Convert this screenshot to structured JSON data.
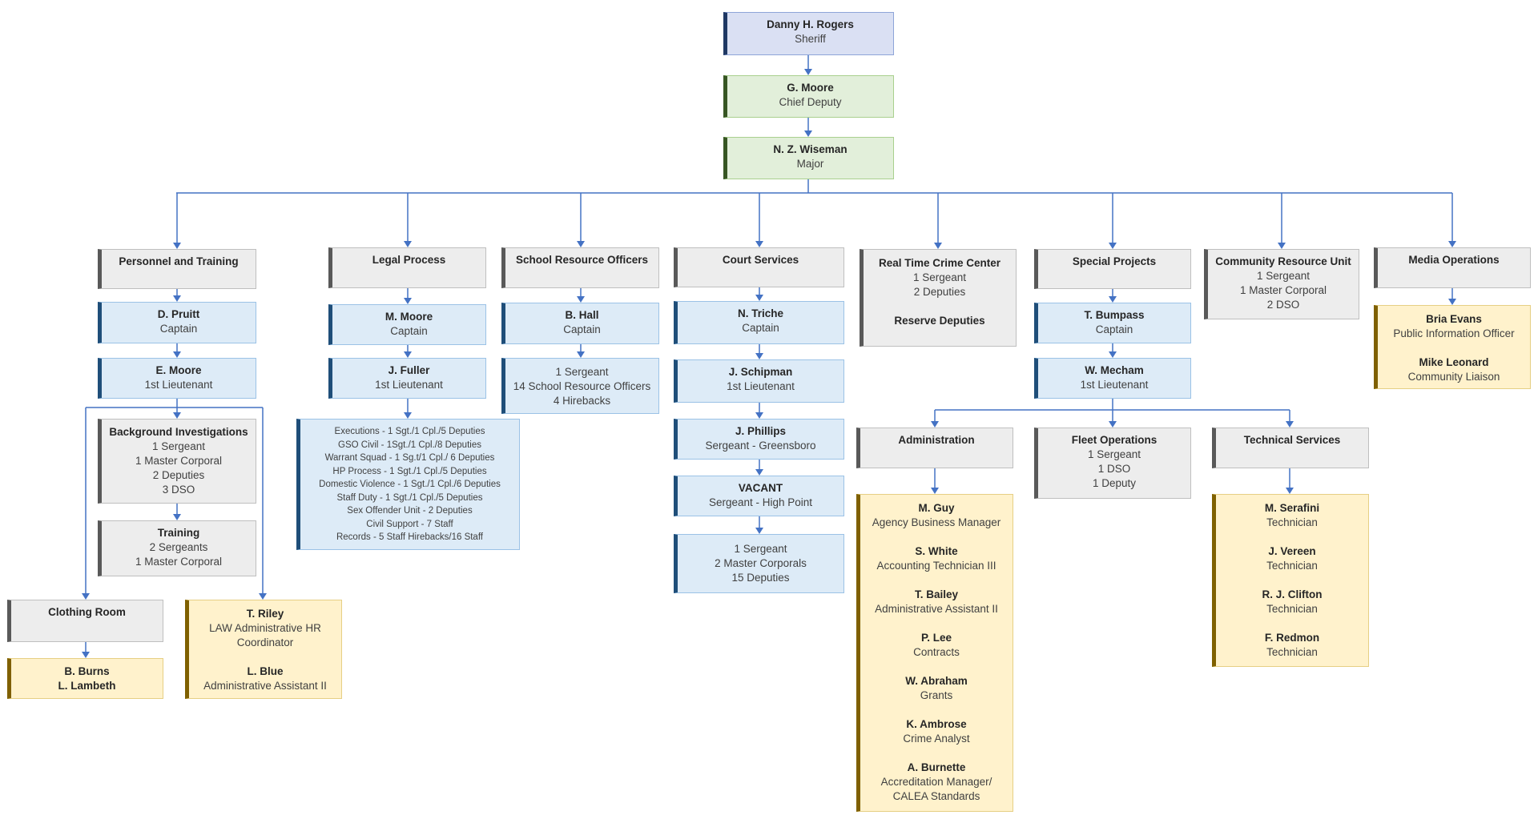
{
  "palette": {
    "connector": "#4472c4",
    "sheriff": {
      "fill": "#dae0f3",
      "border": "#8ea4d8",
      "bar": "#1f3864"
    },
    "command": {
      "fill": "#e2efda",
      "border": "#a9d08e",
      "bar": "#375623"
    },
    "unit": {
      "fill": "#ededed",
      "border": "#bfbfbf",
      "bar": "#595959"
    },
    "officer": {
      "fill": "#ddebf7",
      "border": "#9bc2e6",
      "bar": "#1f4e79"
    },
    "civilian": {
      "fill": "#fff2cc",
      "border": "#e6cf84",
      "bar": "#7f6000"
    }
  },
  "nodes": [
    {
      "id": "sheriff",
      "style": "sheriff",
      "lines": [
        {
          "t": "Danny H. Rogers",
          "b": true
        },
        {
          "t": "Sheriff"
        }
      ]
    },
    {
      "id": "chief-deputy",
      "style": "command",
      "lines": [
        {
          "t": "G. Moore",
          "b": true
        },
        {
          "t": "Chief Deputy"
        }
      ]
    },
    {
      "id": "major",
      "style": "command",
      "lines": [
        {
          "t": "N. Z. Wiseman",
          "b": true
        },
        {
          "t": "Major"
        }
      ]
    },
    {
      "id": "personnel-training",
      "style": "unit",
      "lines": [
        {
          "t": "Personnel and Training",
          "b": true
        }
      ]
    },
    {
      "id": "d-pruitt",
      "style": "officer",
      "lines": [
        {
          "t": "D. Pruitt",
          "b": true
        },
        {
          "t": "Captain"
        }
      ]
    },
    {
      "id": "e-moore",
      "style": "officer",
      "lines": [
        {
          "t": "E. Moore",
          "b": true
        },
        {
          "t": "1st Lieutenant"
        }
      ]
    },
    {
      "id": "background-investigations",
      "style": "unit",
      "lines": [
        {
          "t": "Background Investigations",
          "b": true
        },
        {
          "t": "1 Sergeant"
        },
        {
          "t": "1 Master Corporal"
        },
        {
          "t": "2 Deputies"
        },
        {
          "t": "3 DSO"
        }
      ]
    },
    {
      "id": "training",
      "style": "unit",
      "lines": [
        {
          "t": "Training",
          "b": true
        },
        {
          "t": "2 Sergeants"
        },
        {
          "t": "1 Master Corporal"
        }
      ]
    },
    {
      "id": "clothing-room",
      "style": "unit",
      "lines": [
        {
          "t": "Clothing Room",
          "b": true
        }
      ]
    },
    {
      "id": "clothing-staff",
      "style": "civilian",
      "lines": [
        {
          "t": "B. Burns",
          "b": true
        },
        {
          "t": "L. Lambeth",
          "b": true
        }
      ]
    },
    {
      "id": "hr-staff",
      "style": "civilian",
      "lines": [
        {
          "t": "T. Riley",
          "b": true
        },
        {
          "t": "LAW Administrative HR"
        },
        {
          "t": "Coordinator"
        },
        {
          "t": ""
        },
        {
          "t": "L. Blue",
          "b": true
        },
        {
          "t": "Administrative Assistant II"
        }
      ]
    },
    {
      "id": "legal-process",
      "style": "unit",
      "lines": [
        {
          "t": "Legal Process",
          "b": true
        }
      ]
    },
    {
      "id": "m-moore",
      "style": "officer",
      "lines": [
        {
          "t": "M. Moore",
          "b": true
        },
        {
          "t": "Captain"
        }
      ]
    },
    {
      "id": "j-fuller",
      "style": "officer",
      "lines": [
        {
          "t": "J. Fuller",
          "b": true
        },
        {
          "t": "1st Lieutenant"
        }
      ]
    },
    {
      "id": "legal-units",
      "style": "officer",
      "small": true,
      "lines": [
        {
          "t": "Executions - 1 Sgt./1 Cpl./5 Deputies"
        },
        {
          "t": "GSO Civil - 1Sgt./1 Cpl./8 Deputies"
        },
        {
          "t": "Warrant Squad - 1 Sg.t/1 Cpl./ 6 Deputies"
        },
        {
          "t": "HP Process - 1 Sgt./1 Cpl./5 Deputies"
        },
        {
          "t": "Domestic Violence - 1 Sgt./1 Cpl./6 Deputies"
        },
        {
          "t": "Staff Duty - 1 Sgt./1 Cpl./5 Deputies"
        },
        {
          "t": "Sex Offender Unit - 2 Deputies"
        },
        {
          "t": "Civil Support - 7 Staff"
        },
        {
          "t": "Records - 5 Staff Hirebacks/16 Staff"
        }
      ]
    },
    {
      "id": "school-resource-officers",
      "style": "unit",
      "lines": [
        {
          "t": "School Resource Officers",
          "b": true
        }
      ]
    },
    {
      "id": "b-hall",
      "style": "officer",
      "lines": [
        {
          "t": "B. Hall",
          "b": true
        },
        {
          "t": "Captain"
        }
      ]
    },
    {
      "id": "sro-staff",
      "style": "officer",
      "lines": [
        {
          "t": "1 Sergeant"
        },
        {
          "t": "14 School Resource Officers"
        },
        {
          "t": "4 Hirebacks"
        }
      ]
    },
    {
      "id": "court-services",
      "style": "unit",
      "lines": [
        {
          "t": "Court Services",
          "b": true
        }
      ]
    },
    {
      "id": "n-triche",
      "style": "officer",
      "lines": [
        {
          "t": "N. Triche",
          "b": true
        },
        {
          "t": "Captain"
        }
      ]
    },
    {
      "id": "j-schipman",
      "style": "officer",
      "lines": [
        {
          "t": "J. Schipman",
          "b": true
        },
        {
          "t": "1st Lieutenant"
        }
      ]
    },
    {
      "id": "j-phillips",
      "style": "officer",
      "lines": [
        {
          "t": "J. Phillips",
          "b": true
        },
        {
          "t": "Sergeant - Greensboro"
        }
      ]
    },
    {
      "id": "vacant",
      "style": "officer",
      "lines": [
        {
          "t": "VACANT",
          "b": true
        },
        {
          "t": "Sergeant - High Point"
        }
      ]
    },
    {
      "id": "court-staff",
      "style": "officer",
      "lines": [
        {
          "t": "1 Sergeant"
        },
        {
          "t": "2 Master Corporals"
        },
        {
          "t": "15 Deputies"
        }
      ]
    },
    {
      "id": "real-time-crime-center",
      "style": "unit",
      "lines": [
        {
          "t": "Real Time Crime Center",
          "b": true
        },
        {
          "t": "1 Sergeant"
        },
        {
          "t": "2 Deputies"
        },
        {
          "t": ""
        },
        {
          "t": "Reserve Deputies",
          "b": true
        }
      ]
    },
    {
      "id": "special-projects",
      "style": "unit",
      "lines": [
        {
          "t": "Special Projects",
          "b": true
        }
      ]
    },
    {
      "id": "t-bumpass",
      "style": "officer",
      "lines": [
        {
          "t": "T. Bumpass",
          "b": true
        },
        {
          "t": "Captain"
        }
      ]
    },
    {
      "id": "w-mecham",
      "style": "officer",
      "lines": [
        {
          "t": "W. Mecham",
          "b": true
        },
        {
          "t": "1st Lieutenant"
        }
      ]
    },
    {
      "id": "administration",
      "style": "unit",
      "lines": [
        {
          "t": "Administration",
          "b": true
        }
      ]
    },
    {
      "id": "admin-staff",
      "style": "civilian",
      "lines": [
        {
          "t": "M. Guy",
          "b": true
        },
        {
          "t": "Agency Business Manager"
        },
        {
          "t": ""
        },
        {
          "t": "S. White",
          "b": true
        },
        {
          "t": "Accounting Technician III"
        },
        {
          "t": ""
        },
        {
          "t": "T. Bailey",
          "b": true
        },
        {
          "t": "Administrative Assistant II"
        },
        {
          "t": ""
        },
        {
          "t": "P. Lee",
          "b": true
        },
        {
          "t": "Contracts"
        },
        {
          "t": ""
        },
        {
          "t": "W. Abraham",
          "b": true
        },
        {
          "t": "Grants"
        },
        {
          "t": ""
        },
        {
          "t": "K. Ambrose",
          "b": true
        },
        {
          "t": "Crime Analyst"
        },
        {
          "t": ""
        },
        {
          "t": "A. Burnette",
          "b": true
        },
        {
          "t": "Accreditation Manager/"
        },
        {
          "t": "CALEA Standards"
        }
      ]
    },
    {
      "id": "fleet-operations",
      "style": "unit",
      "lines": [
        {
          "t": "Fleet Operations",
          "b": true
        },
        {
          "t": "1 Sergeant"
        },
        {
          "t": "1 DSO"
        },
        {
          "t": "1 Deputy"
        }
      ]
    },
    {
      "id": "technical-services",
      "style": "unit",
      "lines": [
        {
          "t": "Technical Services",
          "b": true
        }
      ]
    },
    {
      "id": "tech-staff",
      "style": "civilian",
      "lines": [
        {
          "t": "M. Serafini",
          "b": true
        },
        {
          "t": "Technician"
        },
        {
          "t": ""
        },
        {
          "t": "J. Vereen",
          "b": true
        },
        {
          "t": "Technician"
        },
        {
          "t": ""
        },
        {
          "t": "R. J. Clifton",
          "b": true
        },
        {
          "t": "Technician"
        },
        {
          "t": ""
        },
        {
          "t": "F. Redmon",
          "b": true
        },
        {
          "t": "Technician"
        }
      ]
    },
    {
      "id": "community-resource-unit",
      "style": "unit",
      "lines": [
        {
          "t": "Community Resource Unit",
          "b": true
        },
        {
          "t": "1 Sergeant"
        },
        {
          "t": "1 Master Corporal"
        },
        {
          "t": "2 DSO"
        }
      ]
    },
    {
      "id": "media-operations",
      "style": "unit",
      "lines": [
        {
          "t": "Media Operations",
          "b": true
        }
      ]
    },
    {
      "id": "media-staff",
      "style": "civilian",
      "lines": [
        {
          "t": "Bria Evans",
          "b": true
        },
        {
          "t": "Public Information Officer"
        },
        {
          "t": ""
        },
        {
          "t": "Mike Leonard",
          "b": true
        },
        {
          "t": "Community Liaison"
        }
      ]
    }
  ]
}
